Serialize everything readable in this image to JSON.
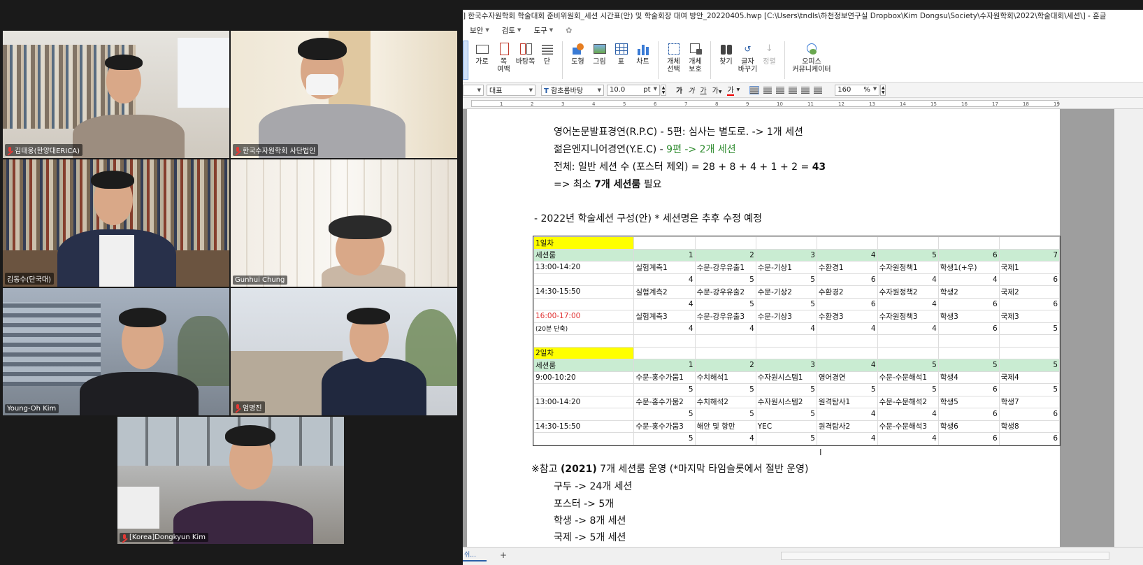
{
  "gallery": {
    "participants": [
      {
        "name": "김태웅(한양대ERICA)",
        "muted": true
      },
      {
        "name": "한국수자원학회 사단법인",
        "muted": true
      },
      {
        "name": "김동수(단국대)",
        "muted": false,
        "speaking": true
      },
      {
        "name": "Gunhui Chung",
        "muted": false
      },
      {
        "name": "Young-Oh Kim",
        "muted": false
      },
      {
        "name": "엄명진",
        "muted": true
      },
      {
        "name": "[Korea]Dongkyun Kim",
        "muted": true
      }
    ]
  },
  "app": {
    "title": "] 한국수자원학회 학술대회 준비위원회_세션 시간표(안) 및 학술회장 대여 방안_20220405.hwp [C:\\Users\\tndls\\하천정보연구실 Dropbox\\Kim Dongsu\\Society\\수자원학회\\2022\\학술대회\\세션\\] - 훈글",
    "menu": [
      "보안",
      "검토",
      "도구"
    ],
    "ribbon": {
      "b1": "가로",
      "b2": "쪽",
      "b2b": "여백",
      "b3": "바탕쪽",
      "b4": "단",
      "b5": "도형",
      "b6": "그림",
      "b7": "표",
      "b8": "차트",
      "b9": "개체",
      "b9b": "선택",
      "b10": "개체",
      "b10b": "보호",
      "b11": "찾기",
      "b12": "글자",
      "b12b": "바꾸기",
      "b13": "정렬",
      "b14": "오피스",
      "b14b": "커뮤니케이터"
    },
    "format": {
      "style": "대표",
      "font": "함초롬바탕",
      "size": "10.0",
      "unit": "pt",
      "zoom": "160",
      "zoom_unit": "%"
    },
    "ruler": [
      "1",
      "2",
      "3",
      "4",
      "5",
      "6",
      "7",
      "8",
      "9",
      "10",
      "11",
      "12",
      "13",
      "14",
      "15",
      "16",
      "17",
      "18",
      "19"
    ],
    "status": {
      "tab": "쉬...",
      "add": "+"
    }
  },
  "doc": {
    "line1": "영어논문발표경연(R.P.C) - 5편: 심사는 별도로. -> 1개 세션",
    "line2a": "젊은엔지니어경연(Y.E.C) - ",
    "line2b": "9편 -> 2개 세션",
    "line3a": "전체: 일반 세션 수 (포스터 제외) = 28 + 8 + 4 + 1 + 2 = ",
    "line3b": "43",
    "line4a": "=> 최소 ",
    "line4b": "7개 세션룸",
    "line4c": " 필요",
    "heading": "- 2022년 학술세션 구성(안) * 세션명은 추후 수정 예정",
    "ref_title_a": "※참고 ",
    "ref_title_b": "(2021)",
    "ref_title_c": " 7개 세션룸 운영 (*마지막 타임슬롯에서 절반 운영)",
    "refs": [
      "구두 -> 24개 세션",
      "포스터 -> 5개",
      "학생 -> 8개 세션",
      "국제 -> 5개 세션"
    ]
  },
  "schedule": {
    "day1": "1일차",
    "day2": "2일차",
    "room_label": "세션룸",
    "day1_rooms": [
      "1",
      "2",
      "3",
      "4",
      "5",
      "6",
      "7"
    ],
    "day2_rooms": [
      "1",
      "2",
      "3",
      "4",
      "5",
      "5",
      "5"
    ],
    "day1_slots": [
      {
        "time": "13:00-14:20",
        "note": "",
        "sessions": [
          "실험계측1",
          "수문-강우유출1",
          "수문-기상1",
          "수환경1",
          "수자원정책1",
          "학생1(+우)",
          "국제1"
        ],
        "counts": [
          "4",
          "5",
          "5",
          "6",
          "4",
          "4",
          "6"
        ]
      },
      {
        "time": "14:30-15:50",
        "note": "",
        "sessions": [
          "실험계측2",
          "수문-강우유출2",
          "수문-기상2",
          "수환경2",
          "수자원정책2",
          "학생2",
          "국제2"
        ],
        "counts": [
          "4",
          "5",
          "5",
          "6",
          "4",
          "6",
          "6"
        ]
      },
      {
        "time": "16:00-17:00",
        "note": "(20분 단축)",
        "sessions": [
          "실험계측3",
          "수문-강우유출3",
          "수문-기상3",
          "수환경3",
          "수자원정책3",
          "학생3",
          "국제3"
        ],
        "counts": [
          "4",
          "4",
          "4",
          "4",
          "4",
          "6",
          "5"
        ]
      }
    ],
    "day2_slots": [
      {
        "time": "9:00-10:20",
        "sessions": [
          "수문-홍수가뭄1",
          "수치해석1",
          "수자원시스템1",
          "영어경연",
          "수문-수문해석1",
          "학생4",
          "국제4"
        ],
        "counts": [
          "5",
          "5",
          "5",
          "5",
          "5",
          "6",
          "5"
        ]
      },
      {
        "time": "13:00-14:20",
        "sessions": [
          "수문-홍수가뭄2",
          "수치해석2",
          "수자원시스템2",
          "원격탐사1",
          "수문-수문해석2",
          "학생5",
          "학생7"
        ],
        "counts": [
          "5",
          "5",
          "5",
          "4",
          "4",
          "6",
          "6"
        ]
      },
      {
        "time": "14:30-15:50",
        "sessions": [
          "수문-홍수가뭄3",
          "해안 및 항만",
          "YEC",
          "원격탐사2",
          "수문-수문해석3",
          "학생6",
          "학생8"
        ],
        "counts": [
          "5",
          "4",
          "5",
          "4",
          "4",
          "6",
          "6"
        ]
      }
    ]
  }
}
